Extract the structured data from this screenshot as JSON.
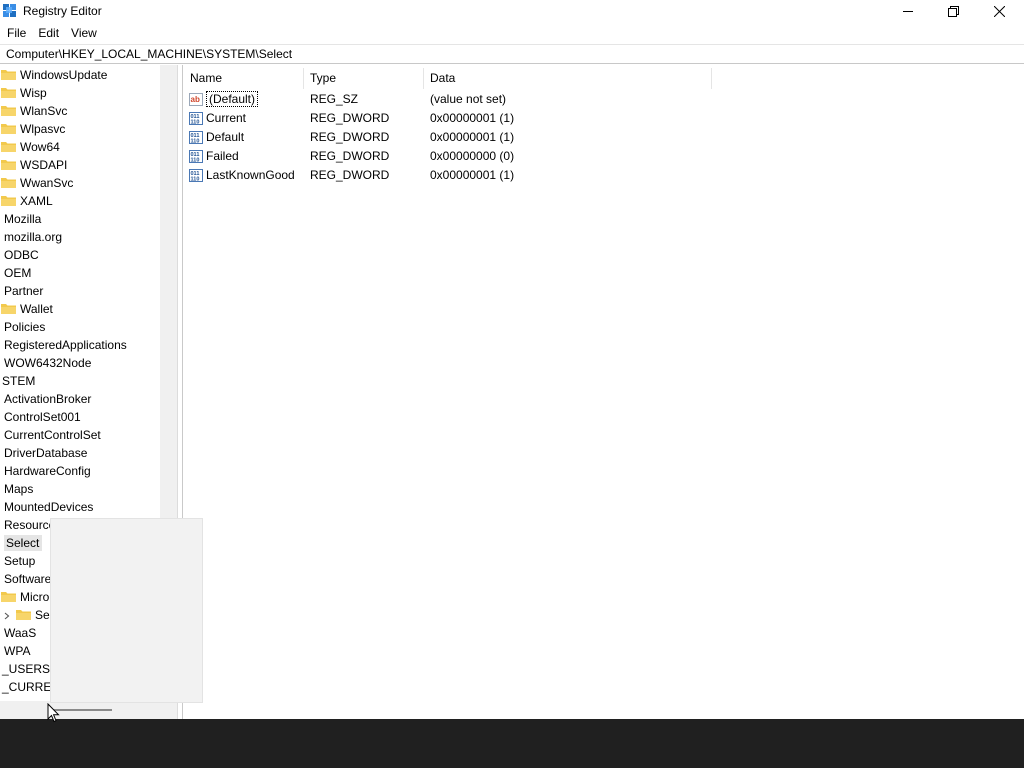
{
  "window": {
    "title": "Registry Editor"
  },
  "menu": {
    "items": [
      "File",
      "Edit",
      "View"
    ]
  },
  "address": {
    "path": "Computer\\HKEY_LOCAL_MACHINE\\SYSTEM\\Select"
  },
  "tree": {
    "items": [
      {
        "label": "WindowsUpdate",
        "folder": true
      },
      {
        "label": "Wisp",
        "folder": true
      },
      {
        "label": "WlanSvc",
        "folder": true
      },
      {
        "label": "Wlpasvc",
        "folder": true
      },
      {
        "label": "Wow64",
        "folder": true
      },
      {
        "label": "WSDAPI",
        "folder": true
      },
      {
        "label": "WwanSvc",
        "folder": true
      },
      {
        "label": "XAML",
        "folder": true
      },
      {
        "label": "Mozilla",
        "folder": false
      },
      {
        "label": "mozilla.org",
        "folder": false
      },
      {
        "label": "ODBC",
        "folder": false
      },
      {
        "label": "OEM",
        "folder": false
      },
      {
        "label": "Partner",
        "folder": false
      },
      {
        "label": "Wallet",
        "folder": true
      },
      {
        "label": "Policies",
        "folder": false
      },
      {
        "label": "RegisteredApplications",
        "folder": false
      },
      {
        "label": "WOW6432Node",
        "folder": false
      },
      {
        "label": "STEM",
        "folder": false
      },
      {
        "label": "ActivationBroker",
        "folder": false
      },
      {
        "label": "ControlSet001",
        "folder": false
      },
      {
        "label": "CurrentControlSet",
        "folder": false
      },
      {
        "label": "DriverDatabase",
        "folder": false
      },
      {
        "label": "HardwareConfig",
        "folder": false
      },
      {
        "label": "Maps",
        "folder": false
      },
      {
        "label": "MountedDevices",
        "folder": false
      },
      {
        "label": "Resource",
        "folder": false
      },
      {
        "label": "Select",
        "folder": false,
        "selected": true
      },
      {
        "label": "Setup",
        "folder": false
      },
      {
        "label": "Software",
        "folder": false
      },
      {
        "label": "Micro",
        "folder": true
      },
      {
        "label": "Se",
        "folder": true,
        "expander": true
      },
      {
        "label": "WaaS",
        "folder": false
      },
      {
        "label": "WPA",
        "folder": false
      },
      {
        "label": "_USERS",
        "folder": false
      },
      {
        "label": "_CURREN",
        "folder": false
      }
    ]
  },
  "list": {
    "columns": {
      "name": "Name",
      "type": "Type",
      "data": "Data"
    },
    "rows": [
      {
        "name": "(Default)",
        "type": "REG_SZ",
        "data": "(value not set)",
        "icon": "string-value-icon"
      },
      {
        "name": "Current",
        "type": "REG_DWORD",
        "data": "0x00000001 (1)",
        "icon": "binary-value-icon"
      },
      {
        "name": "Default",
        "type": "REG_DWORD",
        "data": "0x00000001 (1)",
        "icon": "binary-value-icon"
      },
      {
        "name": "Failed",
        "type": "REG_DWORD",
        "data": "0x00000000 (0)",
        "icon": "binary-value-icon"
      },
      {
        "name": "LastKnownGood",
        "type": "REG_DWORD",
        "data": "0x00000001 (1)",
        "icon": "binary-value-icon"
      }
    ]
  },
  "colors": {
    "folder": "#f2c94c",
    "selection": "#e5e5e5",
    "taskbar": "#202020"
  }
}
